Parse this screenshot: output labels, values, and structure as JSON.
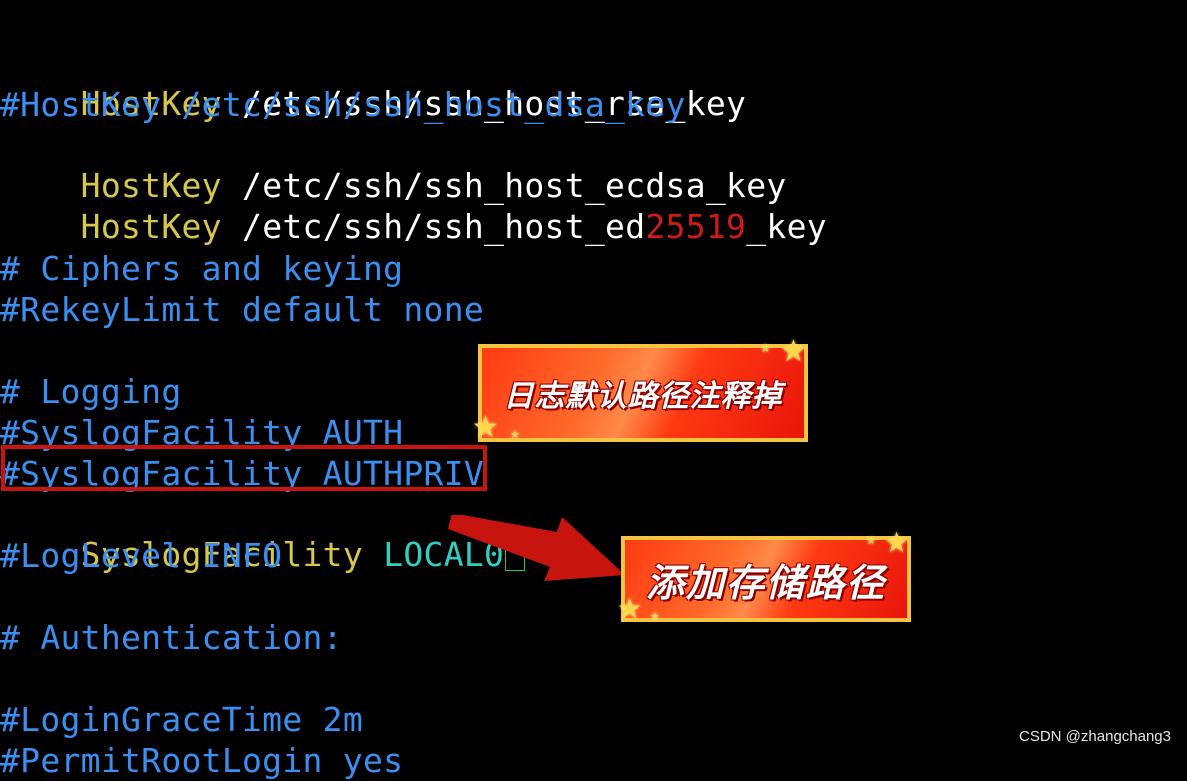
{
  "terminal": {
    "line1": {
      "keyword": "HostKey",
      "value": " /etc/ssh/ssh_host_rsa_key"
    },
    "line2": {
      "text": "#HostKey /etc/ssh/ssh_host_dsa_key"
    },
    "line3": {
      "keyword": "HostKey",
      "value": " /etc/ssh/ssh_host_ecdsa_key"
    },
    "line4": {
      "keyword": "HostKey",
      "value_a": " /etc/ssh/ssh_host_ed",
      "value_num": "25519",
      "value_b": "_key"
    },
    "line5": {
      "text": "# Ciphers and keying"
    },
    "line6": {
      "text": "#RekeyLimit default none"
    },
    "line7": {
      "text": "# Logging"
    },
    "line8": {
      "text": "#SyslogFacility AUTH"
    },
    "line9": {
      "text": "#SyslogFacility AUTHPRIV"
    },
    "line10": {
      "keyword": "SyslogFacility",
      "value": " LOCAL0"
    },
    "line11": {
      "text": "#LogLevel INFO"
    },
    "line12": {
      "text": "# Authentication:"
    },
    "line13": {
      "text": "#LoginGraceTime 2m"
    },
    "line14": {
      "text": "#PermitRootLogin yes"
    }
  },
  "annotations": {
    "badge_comment_out": "日志默认路径注释掉",
    "badge_add_path": "添加存储路径"
  },
  "watermark": "CSDN @zhangchang3",
  "colors": {
    "background": "#000000",
    "keyword": "#d6c64a",
    "comment": "#3a8ff0",
    "value": "#ffffff",
    "number": "#d01c14",
    "local_value": "#2fd0c4",
    "highlight_box": "#c8140e",
    "cursor": "#22c55e"
  }
}
